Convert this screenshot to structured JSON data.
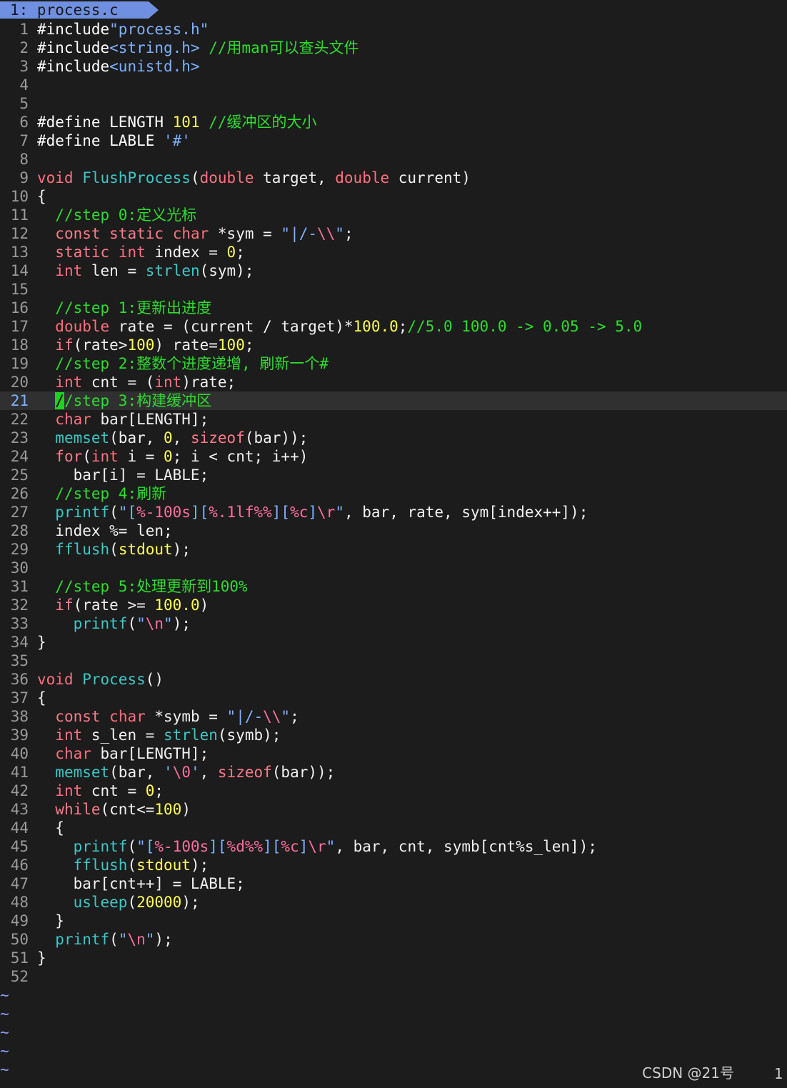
{
  "tab": {
    "label": "1: process.c"
  },
  "watermark": "CSDN @21号",
  "status_right": "1",
  "cursor_line": 21,
  "lines": [
    {
      "n": "1",
      "seg": [
        [
          "pp",
          "#include"
        ],
        [
          "str",
          "\"process.h\""
        ]
      ]
    },
    {
      "n": "2",
      "seg": [
        [
          "pp",
          "#include"
        ],
        [
          "str",
          "<string.h>"
        ],
        [
          "txt",
          " "
        ],
        [
          "cmt",
          "//用man可以查头文件"
        ]
      ]
    },
    {
      "n": "3",
      "seg": [
        [
          "pp",
          "#include"
        ],
        [
          "str",
          "<unistd.h>"
        ]
      ]
    },
    {
      "n": "4",
      "seg": []
    },
    {
      "n": "5",
      "seg": []
    },
    {
      "n": "6",
      "seg": [
        [
          "pp",
          "#define LENGTH "
        ],
        [
          "num",
          "101"
        ],
        [
          "txt",
          " "
        ],
        [
          "cmt",
          "//缓冲区的大小"
        ]
      ]
    },
    {
      "n": "7",
      "seg": [
        [
          "pp",
          "#define LABLE "
        ],
        [
          "str",
          "'#'"
        ]
      ]
    },
    {
      "n": "8",
      "seg": []
    },
    {
      "n": "9",
      "seg": [
        [
          "ty",
          "void"
        ],
        [
          "txt",
          " "
        ],
        [
          "fn",
          "FlushProcess"
        ],
        [
          "txt",
          "("
        ],
        [
          "ty",
          "double"
        ],
        [
          "txt",
          " target, "
        ],
        [
          "ty",
          "double"
        ],
        [
          "txt",
          " current)"
        ]
      ]
    },
    {
      "n": "10",
      "seg": [
        [
          "txt",
          "{"
        ]
      ]
    },
    {
      "n": "11",
      "seg": [
        [
          "txt",
          "  "
        ],
        [
          "cmt",
          "//step 0:定义光标"
        ]
      ]
    },
    {
      "n": "12",
      "seg": [
        [
          "txt",
          "  "
        ],
        [
          "kw",
          "const"
        ],
        [
          "txt",
          " "
        ],
        [
          "kw",
          "static"
        ],
        [
          "txt",
          " "
        ],
        [
          "ty",
          "char"
        ],
        [
          "txt",
          " *sym = "
        ],
        [
          "str",
          "\"|/-"
        ],
        [
          "esc",
          "\\\\"
        ],
        [
          "str",
          "\""
        ],
        [
          "txt",
          ";"
        ]
      ]
    },
    {
      "n": "13",
      "seg": [
        [
          "txt",
          "  "
        ],
        [
          "kw",
          "static"
        ],
        [
          "txt",
          " "
        ],
        [
          "ty",
          "int"
        ],
        [
          "txt",
          " index = "
        ],
        [
          "num",
          "0"
        ],
        [
          "txt",
          ";"
        ]
      ]
    },
    {
      "n": "14",
      "seg": [
        [
          "txt",
          "  "
        ],
        [
          "ty",
          "int"
        ],
        [
          "txt",
          " len = "
        ],
        [
          "fn",
          "strlen"
        ],
        [
          "txt",
          "(sym);"
        ]
      ]
    },
    {
      "n": "15",
      "seg": []
    },
    {
      "n": "16",
      "seg": [
        [
          "txt",
          "  "
        ],
        [
          "cmt",
          "//step 1:更新出进度"
        ]
      ]
    },
    {
      "n": "17",
      "seg": [
        [
          "txt",
          "  "
        ],
        [
          "ty",
          "double"
        ],
        [
          "txt",
          " rate = (current / target)*"
        ],
        [
          "num",
          "100.0"
        ],
        [
          "txt",
          ";"
        ],
        [
          "cmt",
          "//5.0 100.0 -> 0.05 -> 5.0"
        ]
      ]
    },
    {
      "n": "18",
      "seg": [
        [
          "txt",
          "  "
        ],
        [
          "kw",
          "if"
        ],
        [
          "txt",
          "(rate>"
        ],
        [
          "num",
          "100"
        ],
        [
          "txt",
          ") rate="
        ],
        [
          "num",
          "100"
        ],
        [
          "txt",
          ";"
        ]
      ]
    },
    {
      "n": "19",
      "seg": [
        [
          "txt",
          "  "
        ],
        [
          "cmt",
          "//step 2:整数个进度递增, 刷新一个#"
        ]
      ]
    },
    {
      "n": "20",
      "seg": [
        [
          "txt",
          "  "
        ],
        [
          "ty",
          "int"
        ],
        [
          "txt",
          " cnt = ("
        ],
        [
          "ty",
          "int"
        ],
        [
          "txt",
          ")rate;"
        ]
      ]
    },
    {
      "n": "21",
      "seg": [
        [
          "txt",
          "  "
        ],
        [
          "cursor",
          "/"
        ],
        [
          "cmt",
          "/step 3:构建缓冲区"
        ]
      ]
    },
    {
      "n": "22",
      "seg": [
        [
          "txt",
          "  "
        ],
        [
          "ty",
          "char"
        ],
        [
          "txt",
          " bar[LENGTH];"
        ]
      ]
    },
    {
      "n": "23",
      "seg": [
        [
          "txt",
          "  "
        ],
        [
          "fn",
          "memset"
        ],
        [
          "txt",
          "(bar, "
        ],
        [
          "num",
          "0"
        ],
        [
          "txt",
          ", "
        ],
        [
          "kw",
          "sizeof"
        ],
        [
          "txt",
          "(bar));"
        ]
      ]
    },
    {
      "n": "24",
      "seg": [
        [
          "txt",
          "  "
        ],
        [
          "kw",
          "for"
        ],
        [
          "txt",
          "("
        ],
        [
          "ty",
          "int"
        ],
        [
          "txt",
          " i = "
        ],
        [
          "num",
          "0"
        ],
        [
          "txt",
          "; i < cnt; i++)"
        ]
      ]
    },
    {
      "n": "25",
      "seg": [
        [
          "txt",
          "    bar[i] = LABLE;"
        ]
      ]
    },
    {
      "n": "26",
      "seg": [
        [
          "txt",
          "  "
        ],
        [
          "cmt",
          "//step 4:刷新"
        ]
      ]
    },
    {
      "n": "27",
      "seg": [
        [
          "txt",
          "  "
        ],
        [
          "fn",
          "printf"
        ],
        [
          "txt",
          "("
        ],
        [
          "str",
          "\"["
        ],
        [
          "esc",
          "%-100s"
        ],
        [
          "str",
          "]["
        ],
        [
          "esc",
          "%.1lf%%"
        ],
        [
          "str",
          "]["
        ],
        [
          "esc",
          "%c"
        ],
        [
          "str",
          "]"
        ],
        [
          "esc",
          "\\r"
        ],
        [
          "str",
          "\""
        ],
        [
          "txt",
          ", bar, rate, sym[index++]);"
        ]
      ]
    },
    {
      "n": "28",
      "seg": [
        [
          "txt",
          "  index %= len;"
        ]
      ]
    },
    {
      "n": "29",
      "seg": [
        [
          "txt",
          "  "
        ],
        [
          "fn",
          "fflush"
        ],
        [
          "txt",
          "("
        ],
        [
          "num",
          "stdout"
        ],
        [
          "txt",
          ");"
        ]
      ]
    },
    {
      "n": "30",
      "seg": []
    },
    {
      "n": "31",
      "seg": [
        [
          "txt",
          "  "
        ],
        [
          "cmt",
          "//step 5:处理更新到100%"
        ]
      ]
    },
    {
      "n": "32",
      "seg": [
        [
          "txt",
          "  "
        ],
        [
          "kw",
          "if"
        ],
        [
          "txt",
          "(rate >= "
        ],
        [
          "num",
          "100.0"
        ],
        [
          "txt",
          ")"
        ]
      ]
    },
    {
      "n": "33",
      "seg": [
        [
          "txt",
          "    "
        ],
        [
          "fn",
          "printf"
        ],
        [
          "txt",
          "("
        ],
        [
          "str",
          "\""
        ],
        [
          "esc",
          "\\n"
        ],
        [
          "str",
          "\""
        ],
        [
          "txt",
          ");"
        ]
      ]
    },
    {
      "n": "34",
      "seg": [
        [
          "txt",
          "}"
        ]
      ]
    },
    {
      "n": "35",
      "seg": []
    },
    {
      "n": "36",
      "seg": [
        [
          "ty",
          "void"
        ],
        [
          "txt",
          " "
        ],
        [
          "fn",
          "Process"
        ],
        [
          "txt",
          "()"
        ]
      ]
    },
    {
      "n": "37",
      "seg": [
        [
          "txt",
          "{"
        ]
      ]
    },
    {
      "n": "38",
      "seg": [
        [
          "txt",
          "  "
        ],
        [
          "kw",
          "const"
        ],
        [
          "txt",
          " "
        ],
        [
          "ty",
          "char"
        ],
        [
          "txt",
          " *symb = "
        ],
        [
          "str",
          "\"|/-"
        ],
        [
          "esc",
          "\\\\"
        ],
        [
          "str",
          "\""
        ],
        [
          "txt",
          ";"
        ]
      ]
    },
    {
      "n": "39",
      "seg": [
        [
          "txt",
          "  "
        ],
        [
          "ty",
          "int"
        ],
        [
          "txt",
          " s_len = "
        ],
        [
          "fn",
          "strlen"
        ],
        [
          "txt",
          "(symb);"
        ]
      ]
    },
    {
      "n": "40",
      "seg": [
        [
          "txt",
          "  "
        ],
        [
          "ty",
          "char"
        ],
        [
          "txt",
          " bar[LENGTH];"
        ]
      ]
    },
    {
      "n": "41",
      "seg": [
        [
          "txt",
          "  "
        ],
        [
          "fn",
          "memset"
        ],
        [
          "txt",
          "(bar, "
        ],
        [
          "str",
          "'"
        ],
        [
          "esc",
          "\\0"
        ],
        [
          "str",
          "'"
        ],
        [
          "txt",
          ", "
        ],
        [
          "kw",
          "sizeof"
        ],
        [
          "txt",
          "(bar));"
        ]
      ]
    },
    {
      "n": "42",
      "seg": [
        [
          "txt",
          "  "
        ],
        [
          "ty",
          "int"
        ],
        [
          "txt",
          " cnt = "
        ],
        [
          "num",
          "0"
        ],
        [
          "txt",
          ";"
        ]
      ]
    },
    {
      "n": "43",
      "seg": [
        [
          "txt",
          "  "
        ],
        [
          "kw",
          "while"
        ],
        [
          "txt",
          "(cnt<="
        ],
        [
          "num",
          "100"
        ],
        [
          "txt",
          ")"
        ]
      ]
    },
    {
      "n": "44",
      "seg": [
        [
          "txt",
          "  {"
        ]
      ]
    },
    {
      "n": "45",
      "seg": [
        [
          "txt",
          "    "
        ],
        [
          "fn",
          "printf"
        ],
        [
          "txt",
          "("
        ],
        [
          "str",
          "\"["
        ],
        [
          "esc",
          "%-100s"
        ],
        [
          "str",
          "]["
        ],
        [
          "esc",
          "%d%%"
        ],
        [
          "str",
          "]["
        ],
        [
          "esc",
          "%c"
        ],
        [
          "str",
          "]"
        ],
        [
          "esc",
          "\\r"
        ],
        [
          "str",
          "\""
        ],
        [
          "txt",
          ", bar, cnt, symb[cnt%s_len]);"
        ]
      ]
    },
    {
      "n": "46",
      "seg": [
        [
          "txt",
          "    "
        ],
        [
          "fn",
          "fflush"
        ],
        [
          "txt",
          "("
        ],
        [
          "num",
          "stdout"
        ],
        [
          "txt",
          ");"
        ]
      ]
    },
    {
      "n": "47",
      "seg": [
        [
          "txt",
          "    bar[cnt++] = LABLE;"
        ]
      ]
    },
    {
      "n": "48",
      "seg": [
        [
          "txt",
          "    "
        ],
        [
          "fn",
          "usleep"
        ],
        [
          "txt",
          "("
        ],
        [
          "num",
          "20000"
        ],
        [
          "txt",
          ");"
        ]
      ]
    },
    {
      "n": "49",
      "seg": [
        [
          "txt",
          "  }"
        ]
      ]
    },
    {
      "n": "50",
      "seg": [
        [
          "txt",
          "  "
        ],
        [
          "fn",
          "printf"
        ],
        [
          "txt",
          "("
        ],
        [
          "str",
          "\""
        ],
        [
          "esc",
          "\\n"
        ],
        [
          "str",
          "\""
        ],
        [
          "txt",
          ");"
        ]
      ]
    },
    {
      "n": "51",
      "seg": [
        [
          "txt",
          "}"
        ]
      ]
    },
    {
      "n": "52",
      "seg": []
    }
  ],
  "tildes": [
    "~",
    "~",
    "~",
    "~",
    "~"
  ]
}
